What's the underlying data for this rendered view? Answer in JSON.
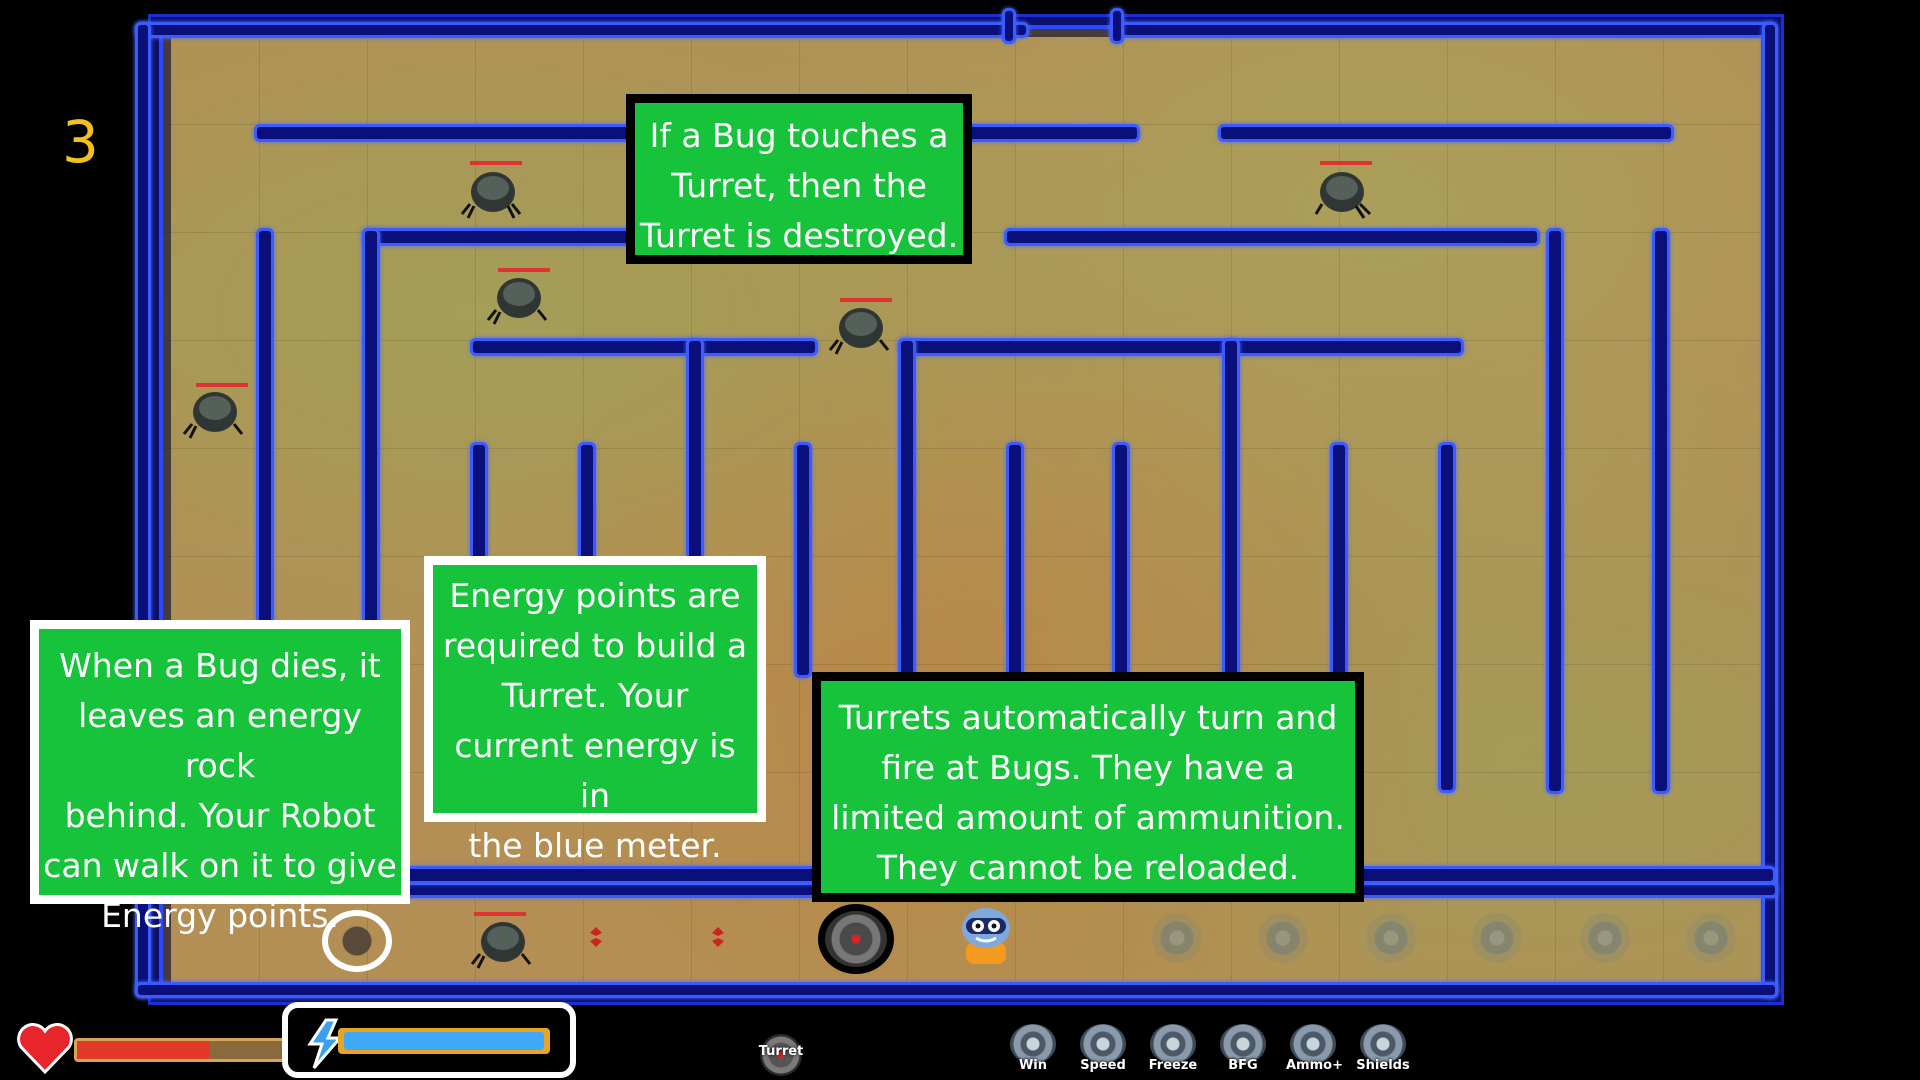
{
  "hud": {
    "level": "3",
    "turret_button_label": "Turret",
    "powerups": [
      {
        "label": "Win"
      },
      {
        "label": "Speed"
      },
      {
        "label": "Freeze"
      },
      {
        "label": "BFG"
      },
      {
        "label": "Ammo+"
      },
      {
        "label": "Shields"
      }
    ],
    "health_fraction": 0.62,
    "energy_fraction": 1.0,
    "colors": {
      "health": "#e23a2a",
      "energy": "#3fa9f5",
      "wall": "#2d49ff",
      "tip_bg": "#18c33c",
      "level_text": "#f2c21a"
    }
  },
  "tips": {
    "bug_touch": "If a Bug touches a\nTurret, then the\nTurret is destroyed.",
    "bug_dies": "When a Bug dies, it\nleaves an energy rock\nbehind. Your Robot\ncan walk on it to give\nEnergy points.",
    "energy": "Energy points are\nrequired to build a\nTurret.  Your\ncurrent energy is in\nthe blue meter.",
    "turrets": "Turrets automatically turn and\nfire at Bugs.  They have a\nlimited amount of ammunition.\nThey cannot be reloaded."
  }
}
